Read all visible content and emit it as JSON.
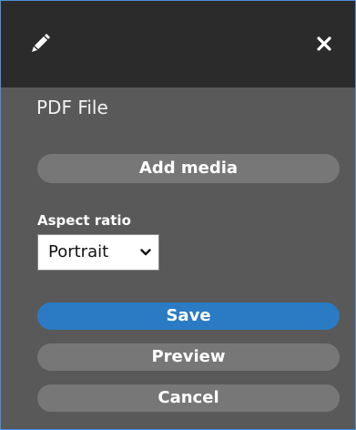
{
  "header": {
    "edit_icon": "pencil-icon",
    "close_icon": "close-icon"
  },
  "document": {
    "title": "PDF File"
  },
  "buttons": {
    "add_media": "Add media",
    "save": "Save",
    "preview": "Preview",
    "cancel": "Cancel"
  },
  "aspect_ratio": {
    "label": "Aspect ratio",
    "selected": "Portrait"
  },
  "colors": {
    "header_bg": "#2b2b2b",
    "panel_bg": "#595959",
    "button_bg": "#777777",
    "primary": "#2a7bc4",
    "border": "#4a90d9"
  }
}
